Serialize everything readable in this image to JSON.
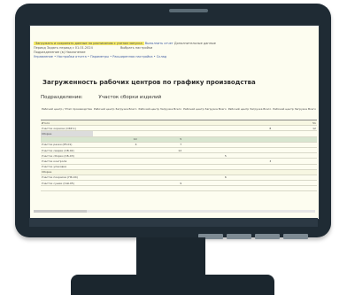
{
  "toolbar": {
    "row1_text": "Загружать и сохранять данные по расписанию с учетом запуска",
    "row1_button": "Выполнить отчет",
    "row1_extra": "Дополнительные данные",
    "row2_label": "Период",
    "row2_value": "Задать период с 01.01.2024",
    "row2_right": "Выбрать настройки",
    "row3_label": "Подразделение",
    "row3_value": "(в) Наклонение",
    "row4_text": "Управление • Настройки отчета • Параметры • Расширенная настройка • Склад"
  },
  "title": "Загруженность рабочих центров по графику производства",
  "subheader": {
    "label": "Подразделение:",
    "value": "Участок сборки изделий"
  },
  "table": {
    "columns": [
      "Рабочий центр / Этап производства",
      "Рабочий центр Загрузка Всего",
      "Рабочий центр Загрузка Всего",
      "Рабочий центр Загрузка Всего",
      "Рабочий центр Загрузка Всего",
      "Рабочий центр Загрузка Всего"
    ],
    "rows": [
      {
        "name": "Итого",
        "c": [
          "",
          "",
          "",
          "",
          "51"
        ],
        "type": "group"
      },
      {
        "name": "Участок окраски (ОКР-1)",
        "c": [
          "",
          "",
          "",
          "8",
          "12"
        ],
        "type": "row"
      },
      {
        "name": "Сборка",
        "c": [
          "",
          "",
          "",
          "",
          ""
        ],
        "type": "sel"
      },
      {
        "name": "",
        "c": [
          "10",
          "5",
          "",
          "",
          ""
        ],
        "type": "hl"
      },
      {
        "name": "Участок резки (РЗ-01)",
        "c": [
          "4",
          "7",
          "",
          "",
          ""
        ],
        "type": "row"
      },
      {
        "name": "Участок сварки (СВ-02)",
        "c": [
          "",
          "12",
          "",
          "",
          ""
        ],
        "type": "row"
      },
      {
        "name": "Участок сборки (СБ-03)",
        "c": [
          "",
          "",
          "5",
          "",
          ""
        ],
        "type": "row"
      },
      {
        "name": "Участок контроля",
        "c": [
          "",
          "",
          "",
          "3",
          ""
        ],
        "type": "row"
      },
      {
        "name": "Участок упаковки",
        "c": [
          "",
          "",
          "",
          "",
          ""
        ],
        "type": "row"
      },
      {
        "name": "Сборка",
        "c": [
          "",
          "",
          "",
          "",
          ""
        ],
        "type": "group"
      },
      {
        "name": "Участок покраски (ПК-04)",
        "c": [
          "",
          "",
          "6",
          "",
          ""
        ],
        "type": "row"
      },
      {
        "name": "Участок сушки (СШ-05)",
        "c": [
          "",
          "9",
          "",
          "",
          ""
        ],
        "type": "row"
      },
      {
        "name": "",
        "c": [
          "",
          "",
          "",
          "",
          ""
        ],
        "type": "row"
      }
    ]
  }
}
